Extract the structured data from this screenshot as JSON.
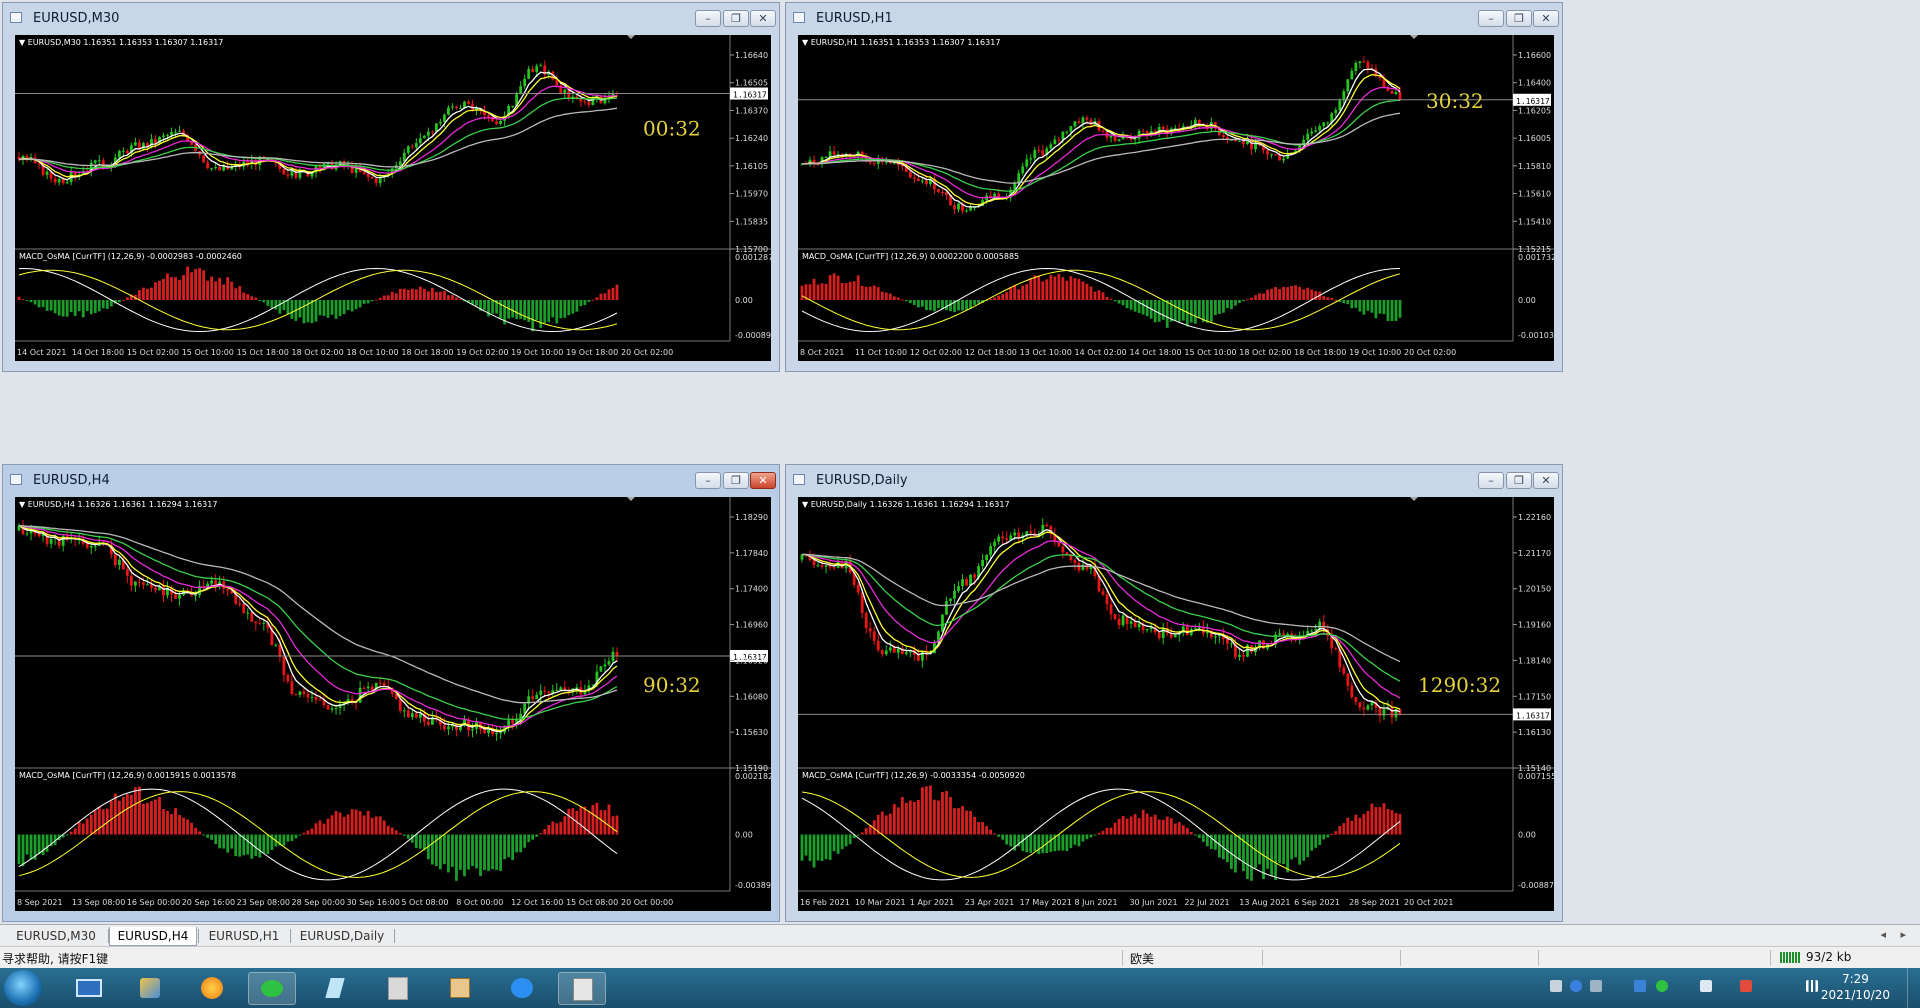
{
  "windows": [
    {
      "id": "m30",
      "title": "EURUSD,M30",
      "info": "EURUSD,M30  1.16351 1.16353 1.16307 1.16317",
      "prices": [
        "1.16640",
        "1.16505",
        "1.16370",
        "1.16240",
        "1.16105",
        "1.15970",
        "1.15835",
        "1.15700"
      ],
      "current_price": "1.16317",
      "macd_label": "MACD_OsMA [CurrTF] (12,26,9) -0.0002983 -0.0002460",
      "macd_scale": [
        "0.0012878",
        "0.00",
        "-0.000895"
      ],
      "dates": [
        "14 Oct 2021",
        "14 Oct 18:00",
        "15 Oct 02:00",
        "15 Oct 10:00",
        "15 Oct 18:00",
        "18 Oct 02:00",
        "18 Oct 10:00",
        "18 Oct 18:00",
        "19 Oct 02:00",
        "19 Oct 10:00",
        "19 Oct 18:00",
        "20 Oct 02:00"
      ],
      "timer": "00:32",
      "trend": [
        0.42,
        0.3,
        0.38,
        0.48,
        0.55,
        0.35,
        0.4,
        0.33,
        0.38,
        0.3,
        0.5,
        0.7,
        0.62,
        0.9,
        0.72,
        0.74
      ],
      "hist_seed": 3
    },
    {
      "id": "h1",
      "title": "EURUSD,H1",
      "info": "EURUSD,H1  1.16351 1.16353 1.16307 1.16317",
      "prices": [
        "1.16600",
        "1.16400",
        "1.16205",
        "1.16005",
        "1.15810",
        "1.15610",
        "1.15410",
        "1.15215"
      ],
      "current_price": "1.16317",
      "macd_label": "MACD_OsMA [CurrTF] (12,26,9) 0.0002200 0.0005885",
      "macd_scale": [
        "0.0017326",
        "0.00",
        "-0.001031"
      ],
      "dates": [
        "8 Oct 2021",
        "11 Oct 10:00",
        "12 Oct 02:00",
        "12 Oct 18:00",
        "13 Oct 10:00",
        "14 Oct 02:00",
        "14 Oct 18:00",
        "15 Oct 10:00",
        "18 Oct 02:00",
        "18 Oct 18:00",
        "19 Oct 10:00",
        "20 Oct 02:00"
      ],
      "timer": "30:32",
      "trend": [
        0.38,
        0.44,
        0.4,
        0.3,
        0.15,
        0.22,
        0.45,
        0.62,
        0.52,
        0.56,
        0.6,
        0.5,
        0.42,
        0.58,
        0.92,
        0.74
      ],
      "hist_seed": 7
    },
    {
      "id": "h4",
      "title": "EURUSD,H4",
      "info": "EURUSD,H4  1.16326 1.16361 1.16294 1.16317",
      "prices": [
        "1.18290",
        "1.17840",
        "1.17400",
        "1.16960",
        "1.16520",
        "1.16080",
        "1.15630",
        "1.15190"
      ],
      "current_price": "1.16317",
      "macd_label": "MACD_OsMA [CurrTF] (12,26,9) 0.0015915 0.0013578",
      "macd_scale": [
        "0.0021826",
        "0.00",
        "-0.003898"
      ],
      "dates": [
        "8 Sep 2021",
        "13 Sep 08:00",
        "16 Sep 00:00",
        "20 Sep 16:00",
        "23 Sep 08:00",
        "28 Sep 00:00",
        "30 Sep 16:00",
        "5 Oct 08:00",
        "8 Oct 00:00",
        "12 Oct 16:00",
        "15 Oct 08:00",
        "20 Oct 00:00"
      ],
      "timer": "90:32",
      "trend": [
        0.92,
        0.88,
        0.86,
        0.7,
        0.66,
        0.7,
        0.55,
        0.25,
        0.2,
        0.28,
        0.15,
        0.12,
        0.1,
        0.24,
        0.26,
        0.4
      ],
      "hist_seed": 11
    },
    {
      "id": "daily",
      "title": "EURUSD,Daily",
      "info": "EURUSD,Daily  1.16326 1.16361 1.16294 1.16317",
      "prices": [
        "1.22160",
        "1.21170",
        "1.20150",
        "1.19160",
        "1.18140",
        "1.17150",
        "1.16130",
        "1.15140"
      ],
      "current_price": "1.16317",
      "macd_label": "MACD_OsMA [CurrTF] (12,26,9) -0.0033354 -0.0050920",
      "macd_scale": [
        "0.0071554",
        "0.00",
        "-0.008872"
      ],
      "dates": [
        "16 Feb 2021",
        "10 Mar 2021",
        "1 Apr 2021",
        "23 Apr 2021",
        "17 May 2021",
        "8 Jun 2021",
        "30 Jun 2021",
        "22 Jul 2021",
        "13 Aug 2021",
        "6 Sep 2021",
        "28 Sep 2021",
        "20 Oct 2021"
      ],
      "timer": "1290:32",
      "trend": [
        0.8,
        0.78,
        0.42,
        0.4,
        0.7,
        0.88,
        0.92,
        0.78,
        0.55,
        0.5,
        0.52,
        0.42,
        0.48,
        0.52,
        0.2,
        0.16
      ],
      "hist_seed": 17
    }
  ],
  "tabs": [
    "EURUSD,M30",
    "EURUSD,H4",
    "EURUSD,H1",
    "EURUSD,Daily"
  ],
  "active_tab": "EURUSD,H4",
  "status": {
    "help": "寻求帮助, 请按F1键",
    "profile": "欧美",
    "traffic": "93/2 kb"
  },
  "clock": {
    "time": "7:29",
    "date": "2021/10/20"
  },
  "colors": {
    "candle_up": "#25c41f",
    "candle_down": "#e81616",
    "ma_white": "#ffffff",
    "ma_yellow": "#ffff33",
    "ma_magenta": "#e82ad8",
    "ma_green": "#3ccf4a",
    "ma_gray": "#b9b9b9",
    "timer": "#e6d33a",
    "hist_up": "#d81f1f",
    "hist_down": "#1b9e2a"
  },
  "taskbar_icons": [
    "start-orb-icon",
    "desktop-icon",
    "control-panel-icon",
    "browser-icon",
    "wechat-icon",
    "notepad-icon",
    "terminal-icon",
    "chart-app-icon",
    "chat-app-icon",
    "mt4-icon"
  ]
}
